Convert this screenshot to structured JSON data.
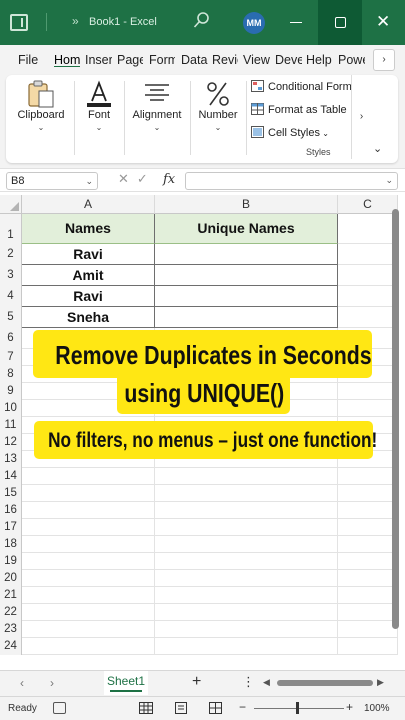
{
  "titlebar": {
    "title": "Book1  -  Excel",
    "avatar_initials": "MM",
    "nav_chevron": "»"
  },
  "tabs": {
    "file": "File",
    "home": "Home",
    "insert": "Insert",
    "page_layout": "Page Layout",
    "formulas": "Formulas",
    "data": "Data",
    "review": "Review",
    "view": "View",
    "developer": "Developer",
    "help": "Help",
    "power": "Power Pivot",
    "more": "›"
  },
  "ribbon": {
    "clipboard": "Clipboard",
    "font": "Font",
    "alignment": "Alignment",
    "number": "Number",
    "conditional_formatting": "Conditional Formatting",
    "format_as_table": "Format as Table",
    "cell_styles": "Cell Styles",
    "styles_group": "Styles",
    "scroll": "›",
    "collapse": "⌄"
  },
  "formula_bar": {
    "name_box": "B8",
    "fx": "fx",
    "value": ""
  },
  "grid": {
    "columns": [
      "A",
      "B",
      "C"
    ],
    "rows": [
      "1",
      "2",
      "3",
      "4",
      "5",
      "6",
      "7",
      "8",
      "9",
      "10",
      "11",
      "12",
      "13",
      "14",
      "15",
      "16",
      "17",
      "18",
      "19",
      "20",
      "21",
      "22",
      "23",
      "24"
    ],
    "header_names": "Names",
    "header_unique": "Unique Names",
    "names": [
      "Ravi",
      "Amit",
      "Ravi",
      "Sneha"
    ]
  },
  "overlay": {
    "headline_line1": "Remove Duplicates in Seconds",
    "headline_line2": "using UNIQUE()",
    "subline": "No filters, no menus – just one function!",
    "highlight_color": "#ffe714"
  },
  "sheetbar": {
    "sheet_name": "Sheet1",
    "add": "+",
    "kebab": "⋮",
    "prev": "‹",
    "next": "›"
  },
  "statusbar": {
    "ready": "Ready",
    "zoom": "100%",
    "zoom_minus": "−",
    "zoom_plus": "+"
  },
  "colors": {
    "excel_green": "#1e7145",
    "header_fill": "#e2efda"
  }
}
